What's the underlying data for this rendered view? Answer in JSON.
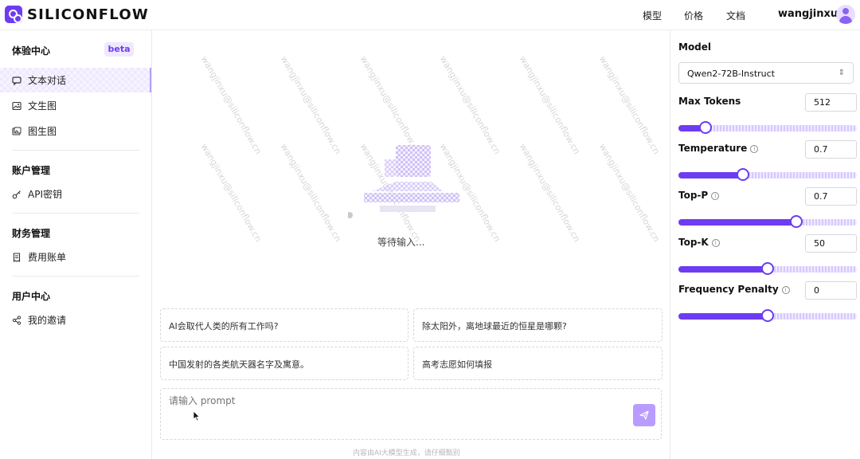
{
  "brand": {
    "name": "SILICONFLOW"
  },
  "topnav": {
    "items": [
      {
        "label": "模型"
      },
      {
        "label": "价格"
      },
      {
        "label": "文档"
      }
    ],
    "username": "wangjinxu"
  },
  "sidebar": {
    "sections": [
      {
        "title": "体验中心",
        "badge": "beta"
      },
      {
        "title": "账户管理"
      },
      {
        "title": "财务管理"
      },
      {
        "title": "用户中心"
      }
    ],
    "items": [
      {
        "label": "文本对话",
        "icon": "chat-icon",
        "active": true
      },
      {
        "label": "文生图",
        "icon": "image-icon"
      },
      {
        "label": "图生图",
        "icon": "images-icon"
      },
      {
        "label": "API密钥",
        "icon": "key-icon"
      },
      {
        "label": "费用账单",
        "icon": "receipt-icon"
      },
      {
        "label": "我的邀请",
        "icon": "share-icon"
      }
    ]
  },
  "main": {
    "empty_text": "等待输入...",
    "watermark": "wangjinxu@siliconflow.cn",
    "suggestions": [
      "AI会取代人类的所有工作吗?",
      "除太阳外，离地球最近的恒星是哪颗?",
      "中国发射的各类航天器名字及寓意。",
      "高考志愿如何填报"
    ],
    "prompt_placeholder": "请输入 prompt",
    "footnote": "内容由AI大模型生成，请仔细甄别"
  },
  "settings": {
    "model_label": "Model",
    "model_value": "Qwen2-72B-Instruct",
    "params": [
      {
        "label": "Max Tokens",
        "value": "512",
        "fraction": 0.15,
        "info": false
      },
      {
        "label": "Temperature",
        "value": "0.7",
        "fraction": 0.36,
        "info": true
      },
      {
        "label": "Top-P",
        "value": "0.7",
        "fraction": 0.66,
        "info": true
      },
      {
        "label": "Top-K",
        "value": "50",
        "fraction": 0.5,
        "info": true
      },
      {
        "label": "Frequency Penalty",
        "value": "0",
        "fraction": 0.5,
        "info": true
      }
    ]
  },
  "colors": {
    "accent": "#6d3cf2"
  }
}
